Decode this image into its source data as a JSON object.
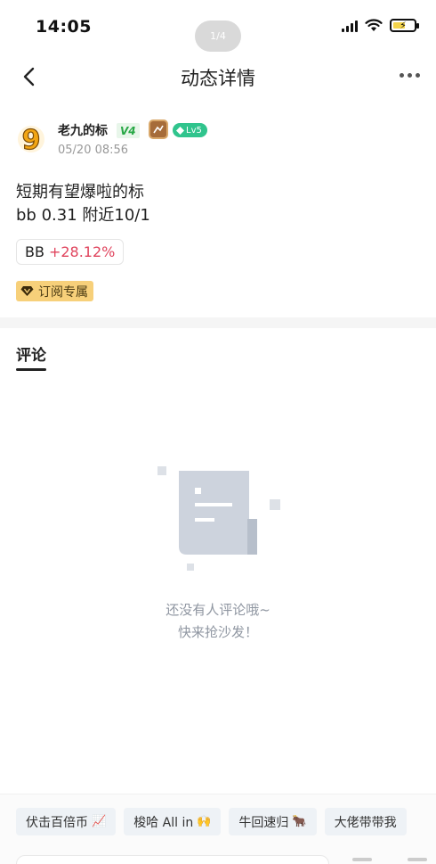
{
  "status_bar": {
    "time": "14:05",
    "page_indicator": "1/4",
    "battery_bolt": "⚡"
  },
  "header": {
    "title": "动态详情"
  },
  "post": {
    "author": {
      "avatar_glyph": "9",
      "name": "老九的标",
      "vip_badge": "V4",
      "level_badge": "Lv5"
    },
    "timestamp": "05/20 08:56",
    "text_lines": [
      "短期有望爆啦的标",
      "bb 0.31 附近10/1"
    ],
    "coin": {
      "symbol": "BB",
      "change": "+28.12%",
      "change_color": "#e0445d"
    },
    "subscription_tag": "订阅专属"
  },
  "comments": {
    "tab_label": "评论",
    "empty_line1": "还没有人评论哦~",
    "empty_line2": "快来抢沙发！"
  },
  "quick_replies": [
    {
      "label": "伏击百倍币",
      "emoji": "📈"
    },
    {
      "label": "梭哈 All in",
      "emoji": "🙌"
    },
    {
      "label": "牛回速归",
      "emoji": "🐂"
    },
    {
      "label": "大佬带带我",
      "emoji": ""
    }
  ],
  "colors": {
    "accent_green": "#27a745",
    "level_green": "#30c48d",
    "sub_gold": "#f7d07a"
  }
}
